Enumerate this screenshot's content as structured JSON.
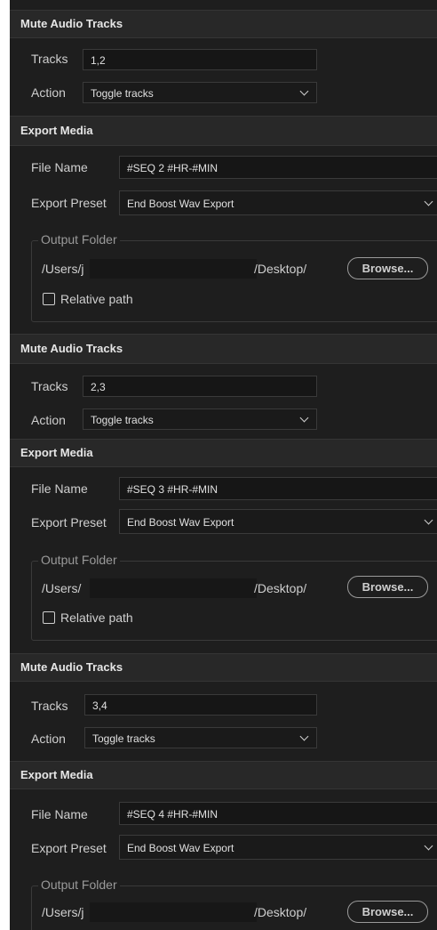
{
  "blocks": [
    {
      "mute": {
        "title": "Mute Audio Tracks",
        "tracks_label": "Tracks",
        "tracks_value": "1,2",
        "action_label": "Action",
        "action_value": "Toggle tracks"
      },
      "export": {
        "title": "Export Media",
        "file_name_label": "File Name",
        "file_name_value": "#SEQ 2  #HR-#MIN",
        "preset_label": "Export Preset",
        "preset_value": "End Boost Wav Export",
        "output_folder_legend": "Output Folder",
        "path_prefix": "/Users/j",
        "path_suffix": "/Desktop/",
        "browse_label": "Browse...",
        "relative_path_label": "Relative path"
      }
    },
    {
      "mute": {
        "title": "Mute Audio Tracks",
        "tracks_label": "Tracks",
        "tracks_value": "2,3",
        "action_label": "Action",
        "action_value": "Toggle tracks"
      },
      "export": {
        "title": "Export Media",
        "file_name_label": "File Name",
        "file_name_value": "#SEQ 3 #HR-#MIN",
        "preset_label": "Export Preset",
        "preset_value": "End Boost Wav Export",
        "output_folder_legend": "Output Folder",
        "path_prefix": "/Users/",
        "path_suffix": "/Desktop/",
        "browse_label": "Browse...",
        "relative_path_label": "Relative path"
      }
    },
    {
      "mute": {
        "title": "Mute Audio Tracks",
        "tracks_label": "Tracks",
        "tracks_value": "3,4",
        "action_label": "Action",
        "action_value": "Toggle tracks"
      },
      "export": {
        "title": "Export Media",
        "file_name_label": "File Name",
        "file_name_value": "#SEQ 4 #HR-#MIN",
        "preset_label": "Export Preset",
        "preset_value": "End Boost Wav Export",
        "output_folder_legend": "Output Folder",
        "path_prefix": "/Users/j",
        "path_suffix": "/Desktop/",
        "browse_label": "Browse..."
      }
    }
  ]
}
